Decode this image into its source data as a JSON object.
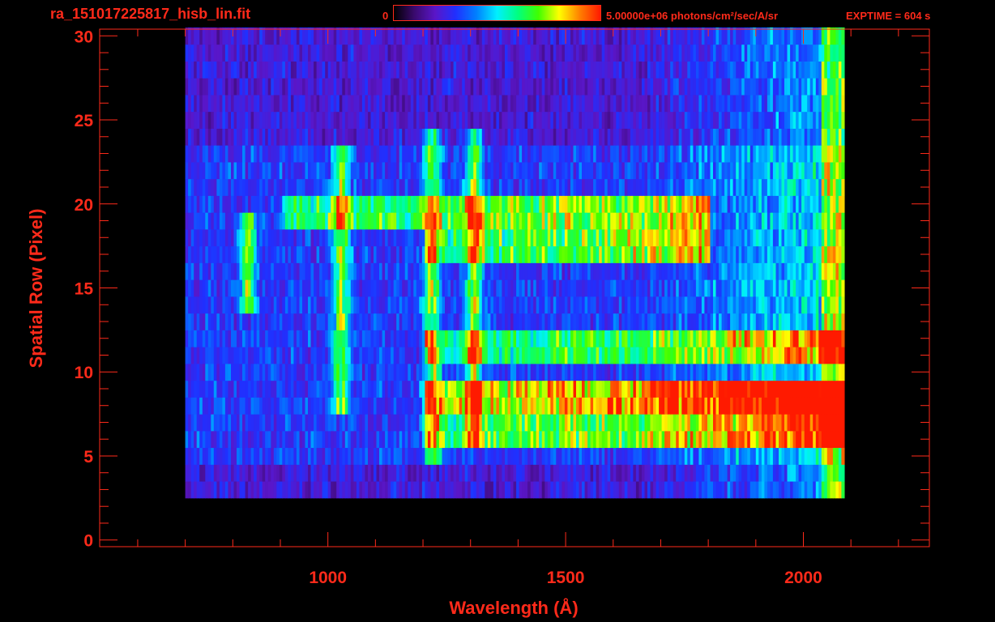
{
  "header": {
    "title": "ra_151017225817_hisb_lin.fit",
    "colorbar_min": "0",
    "colorbar_max": "5.00000e+06 photons/cm²/sec/A/sr",
    "exptime": "EXPTIME = 604 s"
  },
  "colors": {
    "axis": "#ff2a1a",
    "background": "#000000",
    "colormap": [
      "#000000",
      "#3a0a6e",
      "#5a16c8",
      "#2030ff",
      "#0080ff",
      "#00f0ff",
      "#00ff80",
      "#40ff00",
      "#ffff00",
      "#ff8000",
      "#ff1a00"
    ]
  },
  "chart_data": {
    "type": "heatmap",
    "title": "ra_151017225817_hisb_lin.fit",
    "xlabel": "Wavelength (Å)",
    "ylabel": "Spatial Row (Pixel)",
    "xlim": [
      520,
      2265
    ],
    "ylim": [
      -0.4,
      30.4
    ],
    "x_ticks": [
      1000,
      1500,
      2000
    ],
    "y_ticks": [
      0,
      5,
      10,
      15,
      20,
      25,
      30
    ],
    "colorbar_range": [
      0,
      5000000
    ],
    "colorbar_units": "photons/cm²/sec/A/sr",
    "exptime_s": 604,
    "spectrum_x_range": [
      700,
      2080
    ],
    "spectrum_y_range": [
      3,
      30
    ],
    "emission_lines": [
      {
        "wavelength": 830,
        "rows": [
          14,
          19
        ]
      },
      {
        "wavelength": 1025,
        "rows": [
          8,
          23
        ]
      },
      {
        "wavelength": 1216,
        "rows": [
          5,
          24
        ]
      },
      {
        "wavelength": 1304,
        "rows": [
          6,
          24
        ]
      }
    ],
    "bright_rows": [
      {
        "row": 6.5,
        "from": 1200,
        "to": 2080,
        "level": 0.55
      },
      {
        "row": 8.5,
        "from": 1200,
        "to": 2080,
        "level": 0.8
      },
      {
        "row": 11.5,
        "from": 1200,
        "to": 2080,
        "level": 0.45
      },
      {
        "row": 17.5,
        "from": 1200,
        "to": 1800,
        "level": 0.5
      },
      {
        "row": 19.5,
        "from": 900,
        "to": 1800,
        "level": 0.5
      }
    ]
  }
}
